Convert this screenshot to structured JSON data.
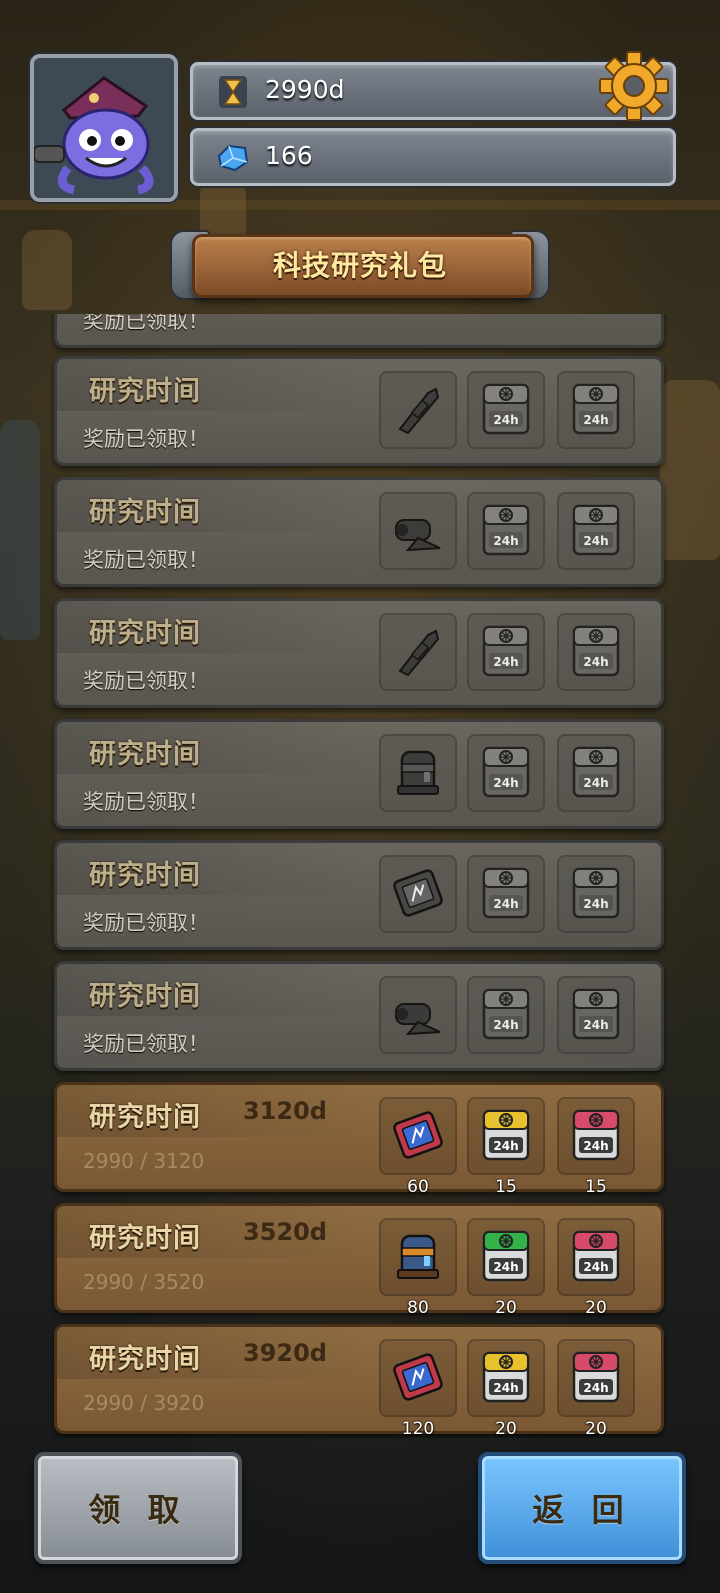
{
  "header": {
    "time_value": "2990d",
    "gem_value": "166",
    "icons": {
      "time": "hourglass-icon",
      "gem": "blue-gem-icon",
      "settings": "gear-icon",
      "avatar": "octopus-pirate-avatar"
    }
  },
  "page_title": "科技研究礼包",
  "rows": [
    {
      "title": "研究时间",
      "target": "",
      "status": "奖励已领取！",
      "state": "claimed",
      "rewards": [
        {
          "icon": "weapon-part-icon",
          "count": ""
        },
        {
          "icon": "supply-crate-24h-icon",
          "count": ""
        },
        {
          "icon": "supply-crate-24h-icon",
          "count": ""
        }
      ]
    },
    {
      "title": "研究时间",
      "target": "",
      "status": "奖励已领取！",
      "state": "claimed",
      "rewards": [
        {
          "icon": "cannon-part-icon",
          "count": ""
        },
        {
          "icon": "supply-crate-24h-icon",
          "count": ""
        },
        {
          "icon": "supply-crate-24h-icon",
          "count": ""
        }
      ]
    },
    {
      "title": "研究时间",
      "target": "",
      "status": "奖励已领取！",
      "state": "claimed",
      "rewards": [
        {
          "icon": "weapon-part-icon",
          "count": ""
        },
        {
          "icon": "supply-crate-24h-icon",
          "count": ""
        },
        {
          "icon": "supply-crate-24h-icon",
          "count": ""
        }
      ]
    },
    {
      "title": "研究时间",
      "target": "",
      "status": "奖励已领取！",
      "state": "claimed",
      "rewards": [
        {
          "icon": "armor-part-icon",
          "count": ""
        },
        {
          "icon": "supply-crate-24h-icon",
          "count": ""
        },
        {
          "icon": "supply-crate-24h-icon",
          "count": ""
        }
      ]
    },
    {
      "title": "研究时间",
      "target": "",
      "status": "奖励已领取！",
      "state": "claimed",
      "rewards": [
        {
          "icon": "blueprint-chip-icon",
          "count": ""
        },
        {
          "icon": "supply-crate-24h-icon",
          "count": ""
        },
        {
          "icon": "supply-crate-24h-icon",
          "count": ""
        }
      ]
    },
    {
      "title": "研究时间",
      "target": "",
      "status": "奖励已领取！",
      "state": "claimed",
      "rewards": [
        {
          "icon": "cannon-part-icon",
          "count": ""
        },
        {
          "icon": "supply-crate-24h-icon",
          "count": ""
        },
        {
          "icon": "supply-crate-24h-icon",
          "count": ""
        }
      ]
    },
    {
      "title": "研究时间",
      "target": "3120d",
      "status": "2990 / 3120",
      "state": "active",
      "rewards": [
        {
          "icon": "blueprint-chip-icon",
          "count": "60"
        },
        {
          "icon": "yellow-crate-24h-icon",
          "count": "15"
        },
        {
          "icon": "red-crate-24h-icon",
          "count": "15"
        }
      ]
    },
    {
      "title": "研究时间",
      "target": "3520d",
      "status": "2990 / 3520",
      "state": "active",
      "rewards": [
        {
          "icon": "armor-part-icon",
          "count": "80"
        },
        {
          "icon": "green-crate-24h-icon",
          "count": "20"
        },
        {
          "icon": "red-crate-24h-icon",
          "count": "20"
        }
      ]
    },
    {
      "title": "研究时间",
      "target": "3920d",
      "status": "2990 / 3920",
      "state": "active",
      "rewards": [
        {
          "icon": "blueprint-chip-icon",
          "count": "120"
        },
        {
          "icon": "yellow-crate-24h-icon",
          "count": "20"
        },
        {
          "icon": "red-crate-24h-icon",
          "count": "20"
        }
      ]
    }
  ],
  "partial_top_status": "奖励已领取！",
  "crate_label": "24h",
  "buttons": {
    "claim": "领 取",
    "back": "返 回"
  }
}
